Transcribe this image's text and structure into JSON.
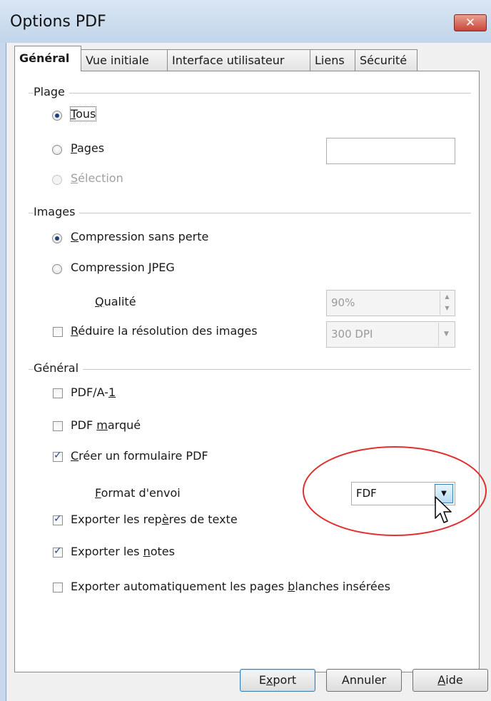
{
  "window": {
    "title": "Options PDF",
    "close_icon": "close-icon"
  },
  "tabs": [
    {
      "label": "Général",
      "active": true
    },
    {
      "label": "Vue initiale",
      "active": false
    },
    {
      "label": "Interface utilisateur",
      "active": false
    },
    {
      "label": "Liens",
      "active": false
    },
    {
      "label": "Sécurité",
      "active": false
    }
  ],
  "plage": {
    "title": "Plage",
    "tous": {
      "u": "T",
      "rest": "ous",
      "checked": true
    },
    "pages": {
      "u": "P",
      "rest": "ages",
      "checked": false,
      "value": ""
    },
    "selection": {
      "u": "S",
      "rest": "élection",
      "disabled": true
    }
  },
  "images": {
    "title": "Images",
    "lossless": {
      "u": "C",
      "rest": "ompression sans perte",
      "checked": true
    },
    "jpeg": {
      "pre": "Compression ",
      "u": "J",
      "rest": "PEG",
      "checked": false
    },
    "quality": {
      "u": "Q",
      "rest": "ualité",
      "value": "90%"
    },
    "reduce": {
      "u": "R",
      "rest": "éduire la résolution des images",
      "checked": false,
      "value": "300 DPI"
    }
  },
  "general": {
    "title": "Général",
    "pdfa": {
      "pre": "PDF/A-",
      "u": "1",
      "checked": false
    },
    "tagged": {
      "pre": "PDF ",
      "u": "m",
      "rest": "arqué",
      "checked": false
    },
    "form": {
      "u": "C",
      "rest": "réer un formulaire PDF",
      "checked": true
    },
    "format": {
      "u": "F",
      "rest": "ormat d'envoi",
      "value": "FDF"
    },
    "bookmarks": {
      "pre": "Exporter les rep",
      "u": "è",
      "rest": "res de texte",
      "checked": true
    },
    "notes": {
      "pre": "Exporter les ",
      "u": "n",
      "rest": "otes",
      "checked": true
    },
    "blank": {
      "pre": "Exporter automatiquement les pages ",
      "u": "b",
      "rest": "lanches insérées",
      "checked": false
    }
  },
  "buttons": {
    "export": {
      "pre": "E",
      "u": "x",
      "rest": "port"
    },
    "cancel": {
      "label": "Annuler"
    },
    "help": {
      "u": "A",
      "rest": "ide"
    }
  },
  "annotation_color": "#e03030"
}
